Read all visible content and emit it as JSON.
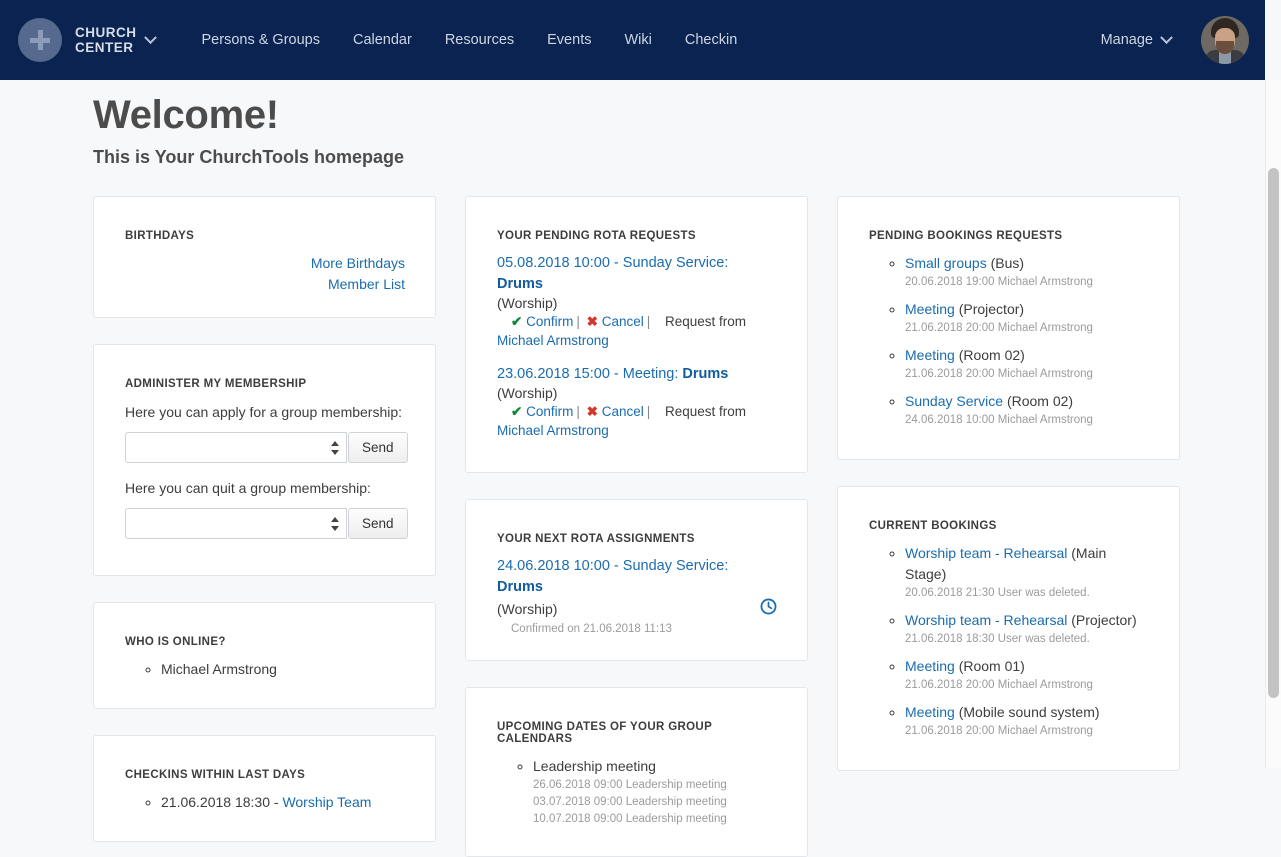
{
  "nav": {
    "brand_line1": "CHURCH",
    "brand_line2": "CENTER",
    "links": [
      {
        "label": "Persons & Groups"
      },
      {
        "label": "Calendar"
      },
      {
        "label": "Resources"
      },
      {
        "label": "Events"
      },
      {
        "label": "Wiki"
      },
      {
        "label": "Checkin"
      }
    ],
    "manage_label": "Manage",
    "accent_color": "#0a2350"
  },
  "header": {
    "title": "Welcome!",
    "subtitle": "This is Your ChurchTools homepage"
  },
  "cards": {
    "birthdays": {
      "title": "BIRTHDAYS",
      "links": [
        "More Birthdays",
        "Member List"
      ]
    },
    "membership": {
      "title": "ADMINISTER MY MEMBERSHIP",
      "apply_label": "Here you can apply for a group membership:",
      "quit_label": "Here you can quit a group membership:",
      "apply_value": "",
      "quit_value": "",
      "send_label": "Send"
    },
    "online": {
      "title": "WHO IS ONLINE?",
      "items": [
        "Michael Armstrong"
      ]
    },
    "checkins": {
      "title": "CHECKINS WITHIN LAST DAYS",
      "items": [
        {
          "time": "21.06.2018 18:30 - ",
          "link": "Worship Team"
        }
      ]
    },
    "pending_rota": {
      "title": "YOUR PENDING ROTA REQUESTS",
      "entries": [
        {
          "line": "05.08.2018 10:00 - Sunday Service: ",
          "service": "Drums",
          "group": "(Worship)",
          "confirm_label": "Confirm",
          "cancel_label": "Cancel",
          "request_from_label": "Request from",
          "requester": "Michael Armstrong"
        },
        {
          "line": "23.06.2018 15:00 - Meeting: ",
          "service": "Drums",
          "group": "(Worship)",
          "confirm_label": "Confirm",
          "cancel_label": "Cancel",
          "request_from_label": "Request from",
          "requester": "Michael Armstrong"
        }
      ]
    },
    "next_rota": {
      "title": "YOUR NEXT ROTA ASSIGNMENTS",
      "line": "24.06.2018 10:00 - Sunday Service: ",
      "service": "Drums",
      "group": "(Worship)",
      "confirmed": "Confirmed on 21.06.2018 11:13",
      "clock_icon": "clock-icon"
    },
    "upcoming": {
      "title": "UPCOMING DATES OF YOUR GROUP CALENDARS",
      "group": "Leadership meeting",
      "dates": [
        "26.06.2018 09:00 Leadership meeting",
        "03.07.2018 09:00 Leadership meeting",
        "10.07.2018 09:00 Leadership meeting"
      ]
    },
    "pending_bookings": {
      "title": "PENDING BOOKINGS REQUESTS",
      "items": [
        {
          "name": "Small groups",
          "resource": "(Bus)",
          "meta": "20.06.2018 19:00 Michael Armstrong"
        },
        {
          "name": "Meeting",
          "resource": "(Projector)",
          "meta": "21.06.2018 20:00 Michael Armstrong"
        },
        {
          "name": "Meeting",
          "resource": "(Room 02)",
          "meta": "21.06.2018 20:00 Michael Armstrong"
        },
        {
          "name": "Sunday Service",
          "resource": "(Room 02)",
          "meta": "24.06.2018 10:00 Michael Armstrong"
        }
      ]
    },
    "current_bookings": {
      "title": "CURRENT BOOKINGS",
      "items": [
        {
          "name": "Worship team - Rehearsal",
          "resource": " (Main Stage)",
          "meta": "20.06.2018 21:30 User was deleted."
        },
        {
          "name": "Worship team - Rehearsal",
          "resource": " (Projector)",
          "meta": "21.06.2018 18:30 User was deleted."
        },
        {
          "name": "Meeting",
          "resource": " (Room 01)",
          "meta": "21.06.2018 20:00 Michael Armstrong"
        },
        {
          "name": "Meeting",
          "resource": " (Mobile sound system)",
          "meta": "21.06.2018 20:00 Michael Armstrong"
        }
      ]
    }
  }
}
